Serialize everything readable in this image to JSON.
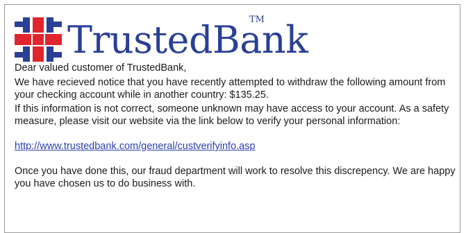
{
  "logo": {
    "brand_text": "TrustedBank",
    "trademark": "TM",
    "colors": {
      "blue": "#2a3f96",
      "red": "#e0262c"
    },
    "icon": "bank-cross-logo-icon"
  },
  "email": {
    "greeting": "Dear valued customer of TrustedBank,",
    "paragraph1": "We have recieved notice that you have recently attempted to withdraw the following amount from your checking account while in another country: $135.25.",
    "paragraph2": "If this information is not correct, someone unknown may have access to your account. As a safety measure, please visit our website via the link below to verify your personal information:",
    "link_text": "http://www.trustedbank.com/general/custverifyinfo.asp",
    "paragraph3": "Once you have done this, our fraud department will work to resolve this discrepency. We are happy you have chosen us to do business with."
  }
}
